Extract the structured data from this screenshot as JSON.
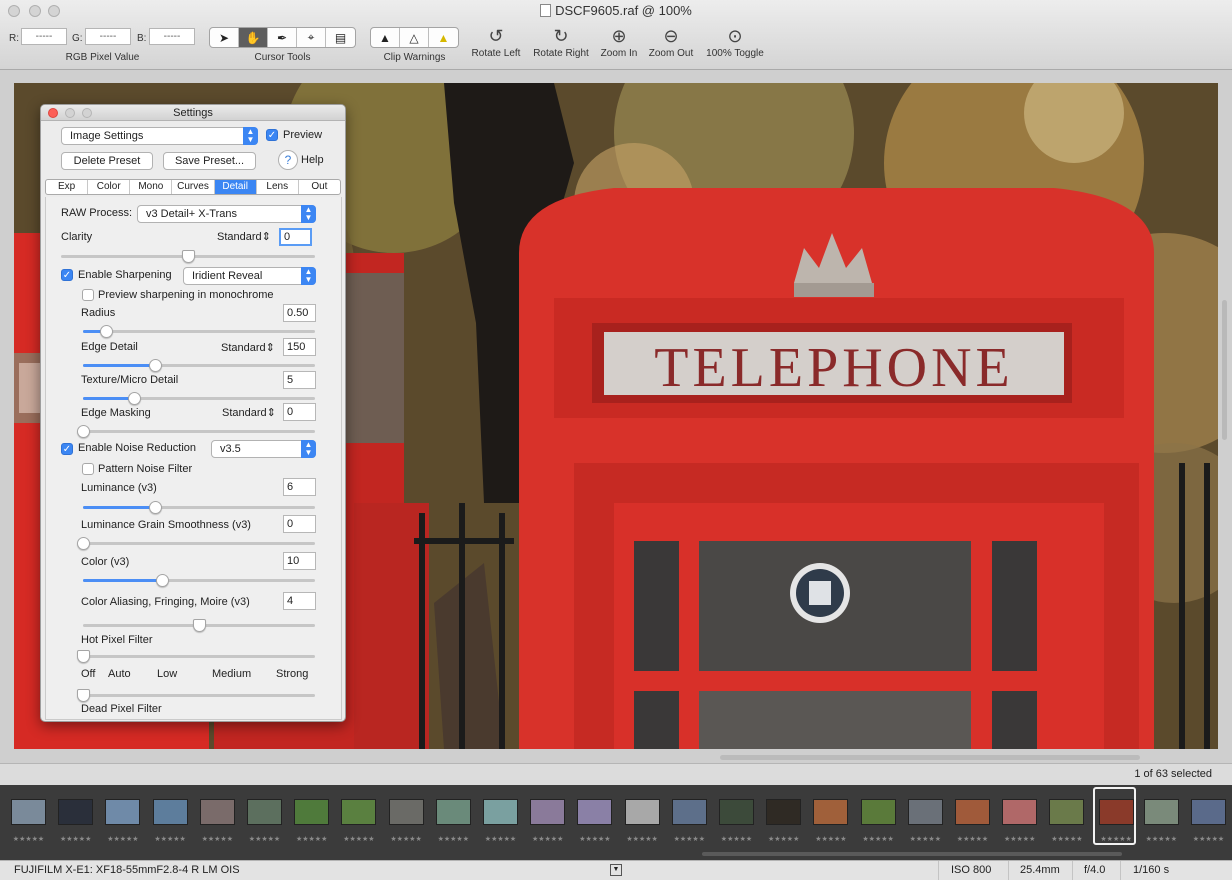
{
  "window": {
    "title": "DSCF9605.raf @ 100%"
  },
  "toolbar": {
    "rgb": {
      "r_label": "R:",
      "g_label": "G:",
      "b_label": "B:",
      "r_value": "-----",
      "g_value": "-----",
      "b_value": "-----",
      "group_label": "RGB Pixel Value"
    },
    "cursor_tools": {
      "label": "Cursor Tools",
      "tools": [
        "arrow-icon",
        "hand-icon",
        "eyedropper-icon",
        "crop-icon",
        "straighten-icon"
      ],
      "active": "hand-icon"
    },
    "clip_warnings": {
      "label": "Clip Warnings",
      "icons": [
        "warning-filled-icon",
        "warning-outline-icon",
        "warning-yellow-icon"
      ]
    },
    "rotate_left": "Rotate Left",
    "rotate_right": "Rotate Right",
    "zoom_in": "Zoom In",
    "zoom_out": "Zoom Out",
    "zoom_toggle": "100% Toggle"
  },
  "photo": {
    "sign_text": "TELEPHONE"
  },
  "settings": {
    "title": "Settings",
    "preset_select": "Image Settings",
    "preview_label": "Preview",
    "preview_checked": true,
    "delete_preset": "Delete Preset",
    "save_preset": "Save Preset...",
    "help_label": "Help",
    "tabs": [
      "Exp",
      "Color",
      "Mono",
      "Curves",
      "Detail",
      "Lens",
      "Out"
    ],
    "active_tab": "Detail",
    "raw_process_label": "RAW Process:",
    "raw_process_value": "v3 Detail+ X-Trans",
    "clarity": {
      "label": "Clarity",
      "mode": "Standard",
      "value": "0",
      "level": 0.5
    },
    "sharpening": {
      "label": "Enable Sharpening",
      "checked": true,
      "method": "Iridient Reveal"
    },
    "preview_mono": {
      "label": "Preview sharpening in monochrome",
      "checked": false
    },
    "radius": {
      "label": "Radius",
      "value": "0.50",
      "level": 0.1
    },
    "edge_detail": {
      "label": "Edge Detail",
      "mode": "Standard",
      "value": "150",
      "level": 0.31
    },
    "texture": {
      "label": "Texture/Micro Detail",
      "value": "5",
      "level": 0.22
    },
    "edge_masking": {
      "label": "Edge Masking",
      "mode": "Standard",
      "value": "0",
      "level": 0.0
    },
    "noise_reduction": {
      "label": "Enable Noise Reduction",
      "checked": true,
      "version": "v3.5"
    },
    "pattern_noise": {
      "label": "Pattern Noise Filter",
      "checked": false
    },
    "luminance": {
      "label": "Luminance (v3)",
      "value": "6",
      "level": 0.31
    },
    "grain": {
      "label": "Luminance Grain Smoothness (v3)",
      "value": "0",
      "level": 0.0
    },
    "color": {
      "label": "Color (v3)",
      "value": "10",
      "level": 0.34
    },
    "aliasing": {
      "label": "Color Aliasing, Fringing, Moire (v3)",
      "value": "4",
      "level": 0.5
    },
    "hot_pixel": {
      "label": "Hot Pixel Filter",
      "ticks": [
        "Off",
        "Auto",
        "Low",
        "Medium",
        "Strong"
      ],
      "level": 0.0
    },
    "dead_pixel": {
      "label": "Dead Pixel Filter",
      "level": 0.0
    }
  },
  "filmstrip": {
    "selection_text": "1 of 63 selected",
    "thumb_colors": [
      "#7a8a9a",
      "#2a2f3a",
      "#6f8aa8",
      "#5d7d9c",
      "#7a6b6a",
      "#5c6f5e",
      "#4f7a3b",
      "#5a8040",
      "#6a6a66",
      "#6a8a7a",
      "#7aa0a0",
      "#8a7a9a",
      "#8a80a6",
      "#a8a8a8",
      "#5d6f8a",
      "#3c4a3a",
      "#2f2a24",
      "#a0603a",
      "#5a7a3a",
      "#6a7078",
      "#a05a3a",
      "#b06868",
      "#6a7a4a",
      "#8a3a2a",
      "#7a8a7a",
      "#5a6a8a"
    ],
    "selected_index": 23,
    "stars": "★★★★★"
  },
  "status": {
    "camera": "FUJIFILM X-E1: XF18-55mmF2.8-4 R LM OIS",
    "iso": "ISO 800",
    "focal": "25.4mm",
    "aperture": "f/4.0",
    "shutter": "1/160 s"
  }
}
